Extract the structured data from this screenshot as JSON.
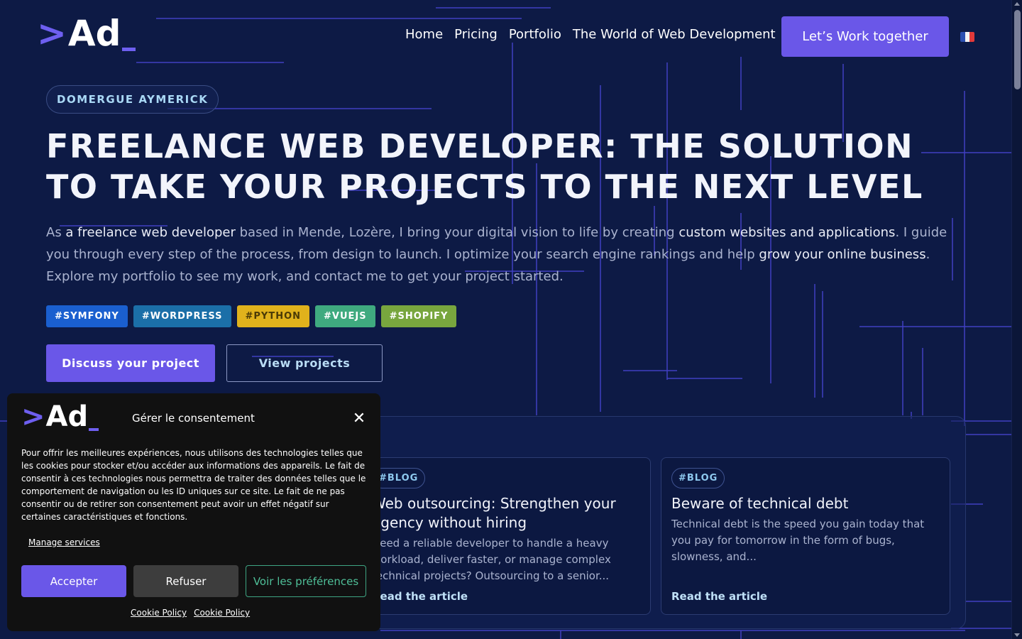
{
  "brand": {
    "chevron": ">",
    "letters": "Ad"
  },
  "nav": {
    "items": [
      {
        "label": "Home"
      },
      {
        "label": "Pricing"
      },
      {
        "label": "Portfolio"
      },
      {
        "label": "The World of Web Development"
      }
    ],
    "cta_label": "Let’s Work together",
    "language_flag": "french-flag-icon"
  },
  "hero": {
    "badge": "DOMERGUE AYMERICK",
    "title": "FREELANCE WEB DEVELOPER: THE SOLUTION TO TAKE YOUR PROJECTS TO THE NEXT LEVEL",
    "intro": {
      "part1": "As ",
      "strong1": "a freelance web developer",
      "part2": " based in Mende, Lozère, I bring your digital vision to life by creating ",
      "strong2": "custom websites and applications",
      "part3": ". I guide you through every step of the process, from design to launch. I optimize your search engine rankings and help ",
      "strong3": "grow your online business",
      "part4": ". Explore my portfolio to see my work, and contact me to get your project started."
    },
    "tags": [
      {
        "label": "#SYMFONY",
        "color": "#1a5fcf"
      },
      {
        "label": "#WORDPRESS",
        "color": "#1b6fa8"
      },
      {
        "label": "#PYTHON",
        "color": "#e0b21c"
      },
      {
        "label": "#VUEJS",
        "color": "#3faa7f"
      },
      {
        "label": "#SHOPIFY",
        "color": "#78a63e"
      }
    ],
    "primary_button": "Discuss your project",
    "secondary_button": "View projects"
  },
  "blog": {
    "cards": [
      {
        "tag": "#BLOG",
        "title": "Web outsourcing: Strengthen your agency without hiring",
        "excerpt": "Need a reliable developer to handle a heavy workload, deliver faster, or manage complex technical projects? Outsourcing to a senior...",
        "link": "Read the article"
      },
      {
        "tag": "#BLOG",
        "title": "Beware of technical debt",
        "excerpt": "Technical debt is the speed you gain today that you pay for tomorrow in the form of bugs, slowness, and...",
        "link": "Read the article"
      }
    ]
  },
  "cookie": {
    "title": "Gérer le consentement",
    "text": "Pour offrir les meilleures expériences, nous utilisons des technologies telles que les cookies pour stocker et/ou accéder aux informations des appareils. Le fait de consentir à ces technologies nous permettra de traiter des données telles que le comportement de navigation ou les ID uniques sur ce site. Le fait de ne pas consentir ou de retirer son consentement peut avoir un effet négatif sur certaines caractéristiques et fonctions.",
    "manage": "Manage services",
    "accept": "Accepter",
    "refuse": "Refuser",
    "preferences": "Voir les préférences",
    "links": [
      "Cookie Policy",
      "Cookie Policy"
    ]
  },
  "colors": {
    "background": "#0d1a45",
    "accent": "#6a57e8",
    "light_blue": "#a9d8f5"
  }
}
